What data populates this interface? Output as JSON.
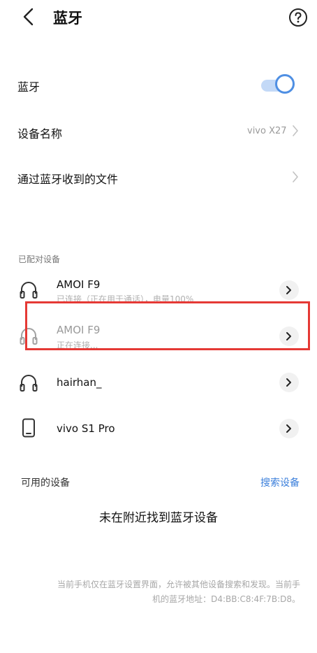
{
  "header": {
    "title": "蓝牙"
  },
  "settings": {
    "bluetooth_label": "蓝牙",
    "bluetooth_on": true,
    "device_name_label": "设备名称",
    "device_name_value": "vivo X27",
    "received_files_label": "通过蓝牙收到的文件"
  },
  "paired": {
    "section_title": "已配对设备",
    "devices": [
      {
        "name": "AMOI F9",
        "status": "已连接（正在用于通话），电量100%",
        "icon": "headphones-icon"
      },
      {
        "name": "AMOI F9",
        "status": "正在连接...",
        "icon": "headphones-icon"
      },
      {
        "name": "hairhan_",
        "status": "",
        "icon": "headphones-icon"
      },
      {
        "name": "vivo S1 Pro",
        "status": "",
        "icon": "phone-icon"
      }
    ]
  },
  "available": {
    "section_title": "可用的设备",
    "search_label": "搜索设备",
    "empty_message": "未在附近找到蓝牙设备"
  },
  "footer": {
    "line1": "当前手机仅在蓝牙设置界面，允许被其他设备搜索和发现。当前手",
    "line2": "机的蓝牙地址：D4:BB:C8:4F:7B:D8。"
  },
  "colors": {
    "accent": "#3b7fdb",
    "toggle_on": "#4f8fe3",
    "highlight": "#e53935"
  }
}
